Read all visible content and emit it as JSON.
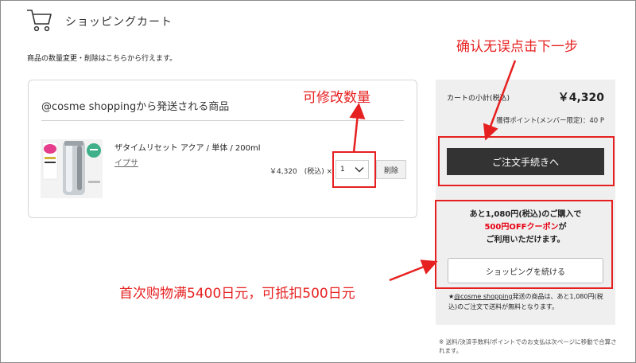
{
  "header": {
    "title": "ショッピングカート",
    "notice": "商品の数量変更・削除はこちらから行えます。"
  },
  "cart": {
    "shop_heading": "@cosme shoppingから発送される商品",
    "item": {
      "name": "ザタイムリセット アクア / 単体 / 200ml",
      "brand": "イプサ",
      "price": "￥4,320　(税込) ×",
      "quantity": "1",
      "delete_label": "削除"
    }
  },
  "summary": {
    "subtotal_label": "カートの小計(税込)",
    "subtotal_value": "￥4,320",
    "points": "獲得ポイント(メンバー限定)：40 P",
    "checkout_label": "ご注文手続きへ",
    "promo": {
      "line1": "あと1,080円(税込)のご購入で",
      "line2_red": "500円OFFクーポン",
      "line2_rest": "が",
      "line3": "ご利用いただけます。"
    },
    "continue_label": "ショッピングを続ける",
    "free_shipping_prefix": "★",
    "free_shipping_link": "@cosme shopping",
    "free_shipping_rest": "発送の商品は、あと1,080円(税込)のご注文で送料が無料となります。"
  },
  "footnote": "※ 送料/決済手数料/ポイントでのお支払は次ページに移動で合算されます。",
  "annotations": {
    "next_step": "确认无误点击下一步",
    "edit_qty": "可修改数量",
    "discount": "首次购物满5400日元，可抵扣500日元"
  },
  "colors": {
    "annotation": "#e62020",
    "checkout_bg": "#333333",
    "coupon_text": "#e60012"
  }
}
